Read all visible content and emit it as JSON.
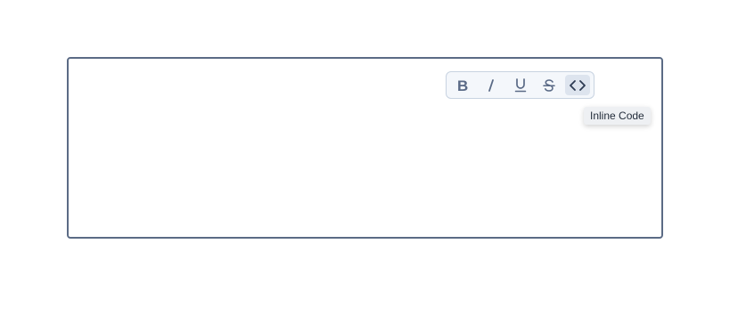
{
  "editor": {
    "content": ""
  },
  "toolbar": {
    "buttons": [
      {
        "icon": "bold-icon",
        "label": "B"
      },
      {
        "icon": "italic-icon",
        "label": "I"
      },
      {
        "icon": "underline-icon",
        "label": "U"
      },
      {
        "icon": "strikethrough-icon",
        "label": "S"
      },
      {
        "icon": "code-icon",
        "label": "<>"
      }
    ],
    "active_button": "code-icon"
  },
  "tooltip": {
    "text": "Inline Code"
  },
  "colors": {
    "border": "#5b6b85",
    "toolbar_bg": "#f4f7fb",
    "toolbar_border": "#c8d3e1",
    "icon": "#5a6a86",
    "active_bg": "#dde4ee"
  }
}
